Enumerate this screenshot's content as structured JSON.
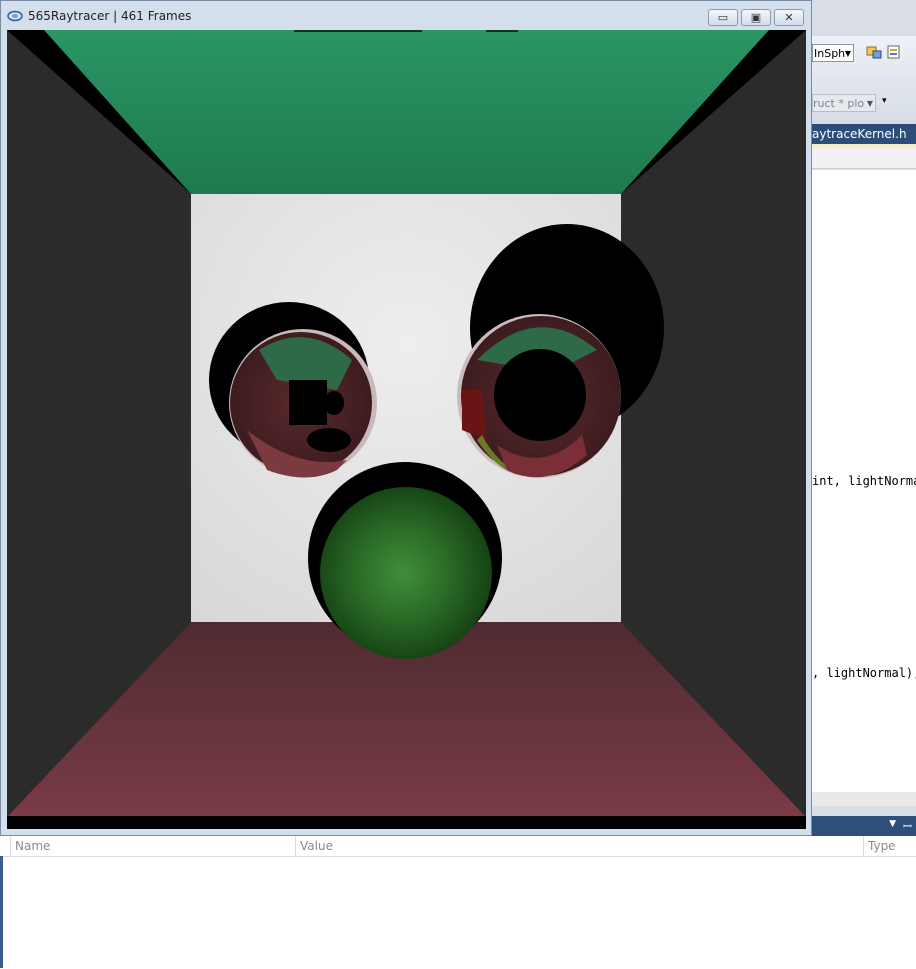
{
  "window": {
    "title": "565Raytracer | 461 Frames",
    "minimize_label": "▭",
    "maximize_label": "▣",
    "close_label": "✕"
  },
  "ide": {
    "combo_value": "InSph",
    "combo2_value": "ruct * plo",
    "file_tab": "aytraceKernel.h",
    "code_lines": [
      "int, lightNormal",
      ", lightNormal);"
    ]
  },
  "watch": {
    "columns": [
      "Name",
      "Value",
      "Type"
    ]
  },
  "scene": {
    "colors": {
      "ceiling": "#2a9565",
      "floor": "#7a3b45",
      "walls": "#2b2b2b",
      "back_wall": "#e2e2e2",
      "green_sphere": "#2e7a2a"
    }
  }
}
